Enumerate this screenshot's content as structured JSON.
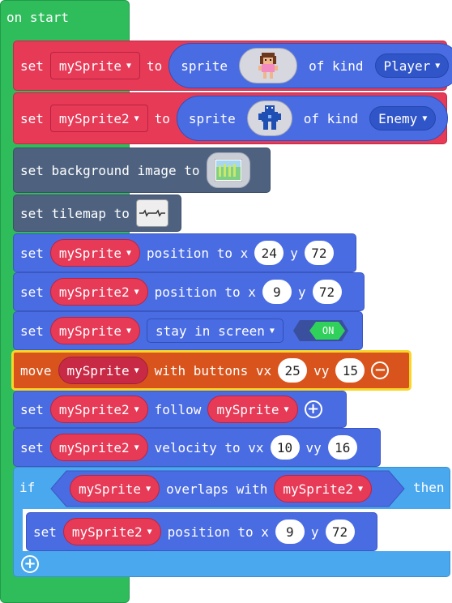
{
  "on_start": {
    "label": "on start"
  },
  "colors": {
    "hat": "#2fbd5c",
    "sprites": "#e63a57",
    "scene": "#4e6280",
    "blocks": "#4a6ce2",
    "controller": "#d9541c",
    "logic": "#4aa8ee",
    "highlight": "#f7d629"
  },
  "blocks": [
    {
      "set": "set",
      "var": "mySprite",
      "to": "to",
      "sprite": "sprite",
      "of_kind": "of kind",
      "kind": "Player",
      "image_icon": "player-sprite-icon"
    },
    {
      "set": "set",
      "var": "mySprite2",
      "to": "to",
      "sprite": "sprite",
      "of_kind": "of kind",
      "kind": "Enemy",
      "image_icon": "enemy-sprite-icon"
    },
    {
      "label": "set background image to",
      "image_icon": "background-image-icon"
    },
    {
      "label": "set tilemap to",
      "image_icon": "tilemap-icon"
    },
    {
      "set": "set",
      "var": "mySprite",
      "label": "position to x",
      "x": "24",
      "y_label": "y",
      "y": "72"
    },
    {
      "set": "set",
      "var": "mySprite2",
      "label": "position to x",
      "x": "9",
      "y_label": "y",
      "y": "72"
    },
    {
      "set": "set",
      "var": "mySprite",
      "prop": "stay in screen",
      "toggle": "ON"
    },
    {
      "move": "move",
      "var": "mySprite",
      "label": "with buttons vx",
      "vx": "25",
      "vy_label": "vy",
      "vy": "15"
    },
    {
      "set": "set",
      "var": "mySprite2",
      "follow": "follow",
      "target": "mySprite"
    },
    {
      "set": "set",
      "var": "mySprite2",
      "label": "velocity to vx",
      "vx": "10",
      "vy_label": "vy",
      "vy": "16"
    },
    {
      "if": "if",
      "a": "mySprite",
      "overlaps": "overlaps with",
      "b": "mySprite2",
      "then": "then"
    },
    {
      "set": "set",
      "var": "mySprite2",
      "label": "position to x",
      "x": "9",
      "y_label": "y",
      "y": "72"
    }
  ]
}
